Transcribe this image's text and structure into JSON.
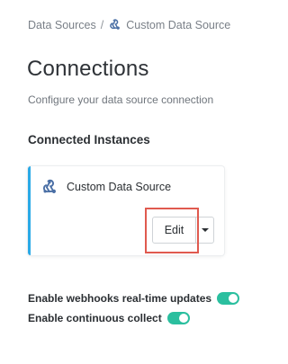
{
  "breadcrumb": {
    "root": "Data Sources",
    "separator": "/",
    "current": "Custom Data Source",
    "icon": "webhook-icon"
  },
  "header": {
    "title": "Connections",
    "subtitle": "Configure your data source connection"
  },
  "instances": {
    "section_title": "Connected Instances",
    "items": [
      {
        "name": "Custom Data Source",
        "icon": "webhook-icon",
        "edit_label": "Edit",
        "dropdown_icon": "caret-down-icon"
      }
    ]
  },
  "settings": {
    "webhooks_label": "Enable webhooks real-time updates",
    "webhooks_enabled": true,
    "continuous_label": "Enable continuous collect",
    "continuous_enabled": true
  },
  "colors": {
    "accent_bar": "#2aa9e6",
    "toggle_on": "#2bbf9f",
    "highlight": "#e05a4f",
    "icon": "#4a6fa5"
  }
}
